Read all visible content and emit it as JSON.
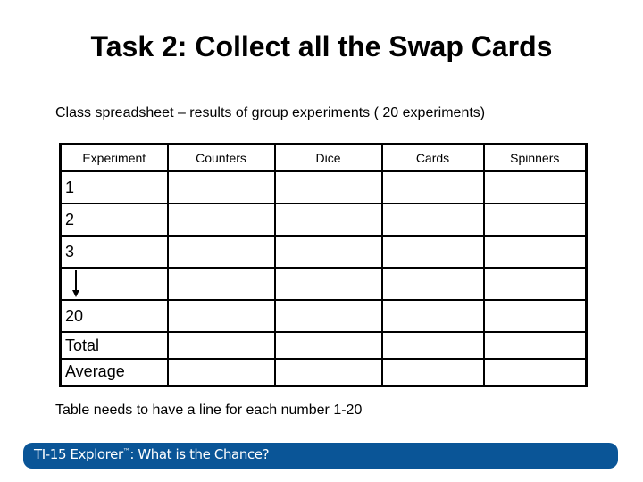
{
  "slide": {
    "title": "Task 2: Collect all the Swap Cards",
    "subtitle": "Class spreadsheet – results of group experiments ( 20 experiments)",
    "note": "Table needs to have a line for each number 1-20"
  },
  "table": {
    "headers": [
      "Experiment",
      "Counters",
      "Dice",
      "Cards",
      "Spinners"
    ],
    "rows": [
      {
        "label": "1",
        "cells": [
          "",
          "",
          "",
          ""
        ]
      },
      {
        "label": "2",
        "cells": [
          "",
          "",
          "",
          ""
        ]
      },
      {
        "label": "3",
        "cells": [
          "",
          "",
          "",
          ""
        ]
      },
      {
        "label": "",
        "icon": "down-arrow-icon",
        "cells": [
          "",
          "",
          "",
          ""
        ]
      },
      {
        "label": "20",
        "cells": [
          "",
          "",
          "",
          ""
        ]
      },
      {
        "label": "Total",
        "cells": [
          "",
          "",
          "",
          ""
        ]
      },
      {
        "label": "Average",
        "cells": [
          "",
          "",
          "",
          ""
        ]
      }
    ]
  },
  "footer": {
    "brand": "TI-15 Explorer",
    "trademark": "™",
    "tagline": ": What is the Chance?",
    "color": "#0a5597"
  }
}
